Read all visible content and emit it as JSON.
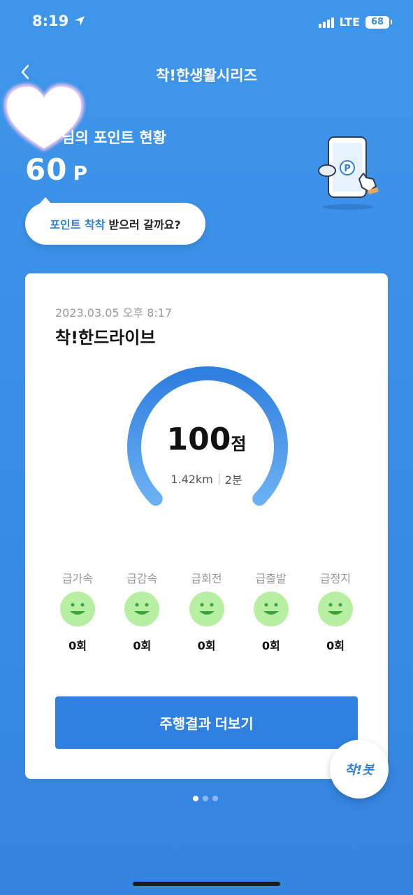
{
  "status_bar": {
    "time": "8:19",
    "network": "LTE",
    "battery": "68"
  },
  "header": {
    "title": "착!한생활시리즈"
  },
  "points": {
    "label": "님의 포인트 현황",
    "value": "60",
    "unit": "P"
  },
  "bubble": {
    "highlight": "포인트 착착",
    "text": "받으러 갈까요?"
  },
  "card": {
    "date": "2023.03.05 오후 8:17",
    "title": "착!한드라이브",
    "score": "100",
    "score_unit": "점",
    "distance": "1.42km",
    "duration": "2분",
    "gauge_fill": 1.0,
    "stats": [
      {
        "label": "급가속",
        "count": "0회"
      },
      {
        "label": "급감속",
        "count": "0회"
      },
      {
        "label": "급회전",
        "count": "0회"
      },
      {
        "label": "급출발",
        "count": "0회"
      },
      {
        "label": "급정지",
        "count": "0회"
      }
    ],
    "more_button": "주행결과 더보기"
  },
  "bot_label": "착!봇",
  "pager": {
    "current": 1,
    "total": 3
  },
  "phone_badge": "P",
  "colors": {
    "primary": "#2f80e0",
    "background": "#3a8fe6",
    "face": "#b7efa3"
  }
}
